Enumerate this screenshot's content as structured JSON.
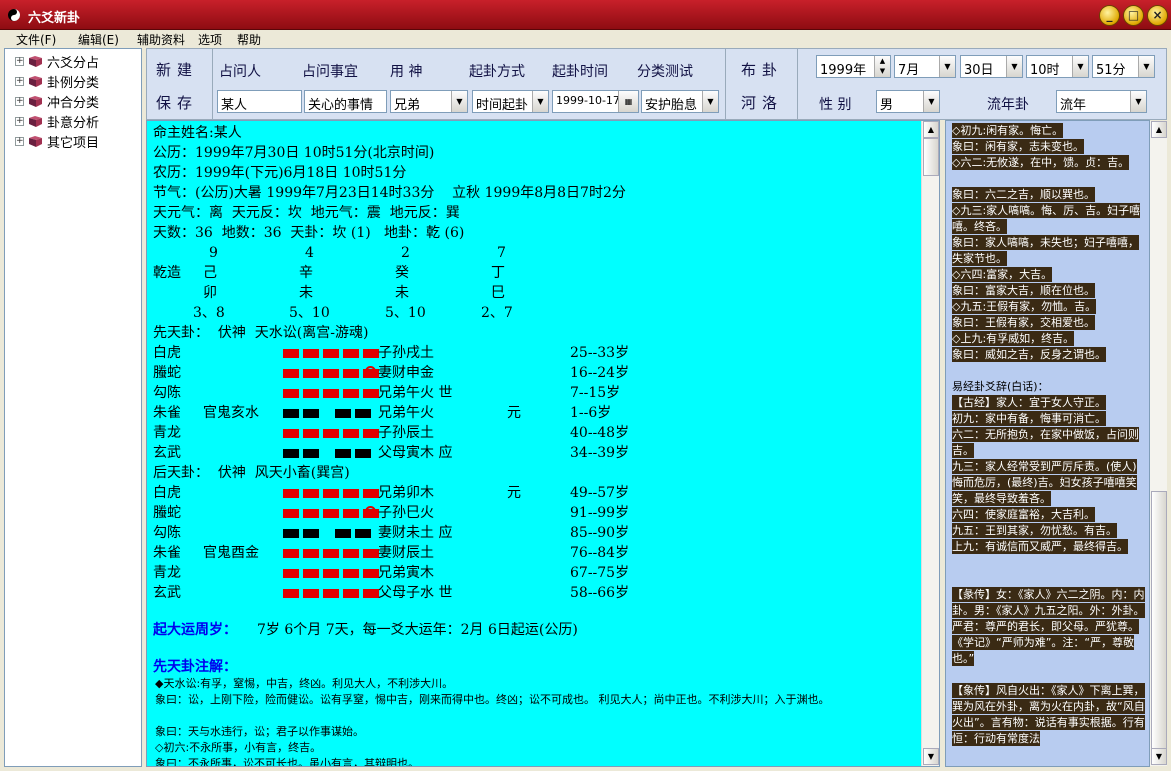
{
  "window": {
    "title": "六爻新卦",
    "min": "_",
    "max": "□",
    "close": "×"
  },
  "menu": [
    "文件(F)",
    "编辑(E)",
    "辅助资料",
    "选项",
    "帮助"
  ],
  "tree": [
    "六爻分占",
    "卦例分类",
    "冲合分类",
    "卦意分析",
    "其它项目"
  ],
  "toolbar": {
    "new": "新建",
    "save": "保存",
    "layout": "布卦",
    "heluo": "河洛",
    "col_person": "占问人",
    "col_matter": "占问事宜",
    "col_god": "用 神",
    "col_method": "起卦方式",
    "col_time": "起卦时间",
    "col_category": "分类测试",
    "person": "某人",
    "matter": "关心的事情",
    "god": "兄弟",
    "method": "时间起卦",
    "time": "1999-10-17",
    "category": "安护胎息",
    "year": "1999年",
    "month": "7月",
    "day": "30日",
    "hour": "10时",
    "minute": "51分",
    "gender_label": "性 别",
    "gender": "男",
    "flow_label": "流年卦",
    "flow": "流年"
  },
  "main": {
    "lines": [
      "命主姓名:某人",
      "公历：1999年7月30日 10时51分(北京时间)",
      "农历：1999年(下元)6月18日 10时51分",
      "节气：(公历)大暑 1999年7月23日14时33分    立秋 1999年8月8日7时2分",
      "天元气：离  天元反：坎  地元气：震  地元反：巽",
      "天数：36  地数：36  天卦：坎 (1)   地卦：乾 (6)"
    ],
    "pillars": {
      "nums": [
        "9",
        "4",
        "2",
        "7"
      ],
      "label": "乾造",
      "stems": [
        "己",
        "辛",
        "癸",
        "丁"
      ],
      "branches": [
        "卯",
        "未",
        "未",
        "巳"
      ],
      "ranges": [
        "3、8",
        "5、10",
        "5、10",
        "2、7"
      ]
    },
    "pre_header": "先天卦：  伏神  天水讼(离宫-游魂)",
    "pre_rows": [
      {
        "god": "白虎",
        "fu": "",
        "yao": "yang",
        "moving": false,
        "rel": "子孙戌土",
        "mark": "",
        "age": "25--33岁"
      },
      {
        "god": "螣蛇",
        "fu": "",
        "yao": "yang",
        "moving": true,
        "rel": "妻财申金",
        "mark": "",
        "age": "16--24岁"
      },
      {
        "god": "勾陈",
        "fu": "",
        "yao": "yang",
        "moving": false,
        "rel": "兄弟午火 世",
        "mark": "",
        "age": "7--15岁"
      },
      {
        "god": "朱雀",
        "fu": "官鬼亥水",
        "yao": "yin",
        "moving": false,
        "rel": "兄弟午火",
        "mark": "元",
        "age": "1--6岁"
      },
      {
        "god": "青龙",
        "fu": "",
        "yao": "yang",
        "moving": false,
        "rel": "子孙辰土",
        "mark": "",
        "age": "40--48岁"
      },
      {
        "god": "玄武",
        "fu": "",
        "yao": "yin",
        "moving": false,
        "rel": "父母寅木 应",
        "mark": "",
        "age": "34--39岁"
      }
    ],
    "post_header": "后天卦：  伏神  风天小畜(巽宫)",
    "post_rows": [
      {
        "god": "白虎",
        "fu": "",
        "yao": "yang",
        "moving": false,
        "rel": "兄弟卯木",
        "mark": "元",
        "age": "49--57岁"
      },
      {
        "god": "螣蛇",
        "fu": "",
        "yao": "yang",
        "moving": true,
        "rel": "子孙巳火",
        "mark": "",
        "age": "91--99岁"
      },
      {
        "god": "勾陈",
        "fu": "",
        "yao": "yin",
        "moving": false,
        "rel": "妻财未土 应",
        "mark": "",
        "age": "85--90岁"
      },
      {
        "god": "朱雀",
        "fu": "官鬼酉金",
        "yao": "yang",
        "moving": false,
        "rel": "妻财辰土",
        "mark": "",
        "age": "76--84岁"
      },
      {
        "god": "青龙",
        "fu": "",
        "yao": "yang",
        "moving": false,
        "rel": "兄弟寅木",
        "mark": "",
        "age": "67--75岁"
      },
      {
        "god": "玄武",
        "fu": "",
        "yao": "yang",
        "moving": false,
        "rel": "父母子水 世",
        "mark": "",
        "age": "58--66岁"
      }
    ],
    "dayun_label": "起大运周岁：",
    "dayun": "7岁 6个月 7天，每一爻大运年：2月 6日起运(公历)",
    "note_title": "先天卦注解：",
    "notes": [
      "◆天水讼:有孚，窒惕，中吉，终凶。利见大人，不利涉大川。",
      "    象曰：讼，上刚下险，险而健讼。讼有孚窒，惕中吉，刚来而得中也。终凶；讼不可成也。  利见大人；尚中正也。不利涉大川；入于渊也。",
      "    象曰：天与水违行，讼；君子以作事谋始。",
      "◇初六:不永所事，小有言，终吉。",
      "    象曰：不永所事，讼不可长也。虽小有言，其辩明也。"
    ]
  },
  "right": {
    "blocks": [
      "◇初九:闲有家。悔亡。",
      "  象曰：闲有家，志未变也。",
      "◇六二:无攸遂，在中，馈。贞：吉。",
      "  象曰：六二之吉，顺以巽也。",
      "◇九三:家人嗃嗃。悔、厉、吉。妇子嘻嘻。终吝。",
      "  象曰：家人嗃嗃，未失也；妇子嘻嘻，失家节也。",
      "◇六四:富家，大吉。",
      "  象曰：富家大吉，顺在位也。",
      "◇九五:王假有家，勿恤。吉。",
      "  象曰：王假有家，交相爱也。",
      "◇上九:有孚威如，终吉。",
      "  象曰：威如之吉，反身之谓也。"
    ],
    "plain_title": "易经卦爻辞(白话)：",
    "plain": [
      "【古经】家人：宜于女人守正。",
      "  初九：家中有备，悔事可消亡。",
      "  六二：无所抱负，在家中做饭，占问则吉。",
      "  九三：家人经常受到严厉斥责。(使人)悔而危厉，(最终)吉。妇女孩子嘻嘻笑笑，最终导致羞吝。",
      "  六四：使家庭富裕，大吉利。",
      "  九五：王到其家，勿忧愁。有吉。",
      "  上九：有诚信而又威严，最终得吉。"
    ],
    "xiang": "【彖传】女：《家人》六二之阴。内：内卦。男：《家人》九五之阳。外：外卦。严君：尊严的君长，即父母。严犹尊。《学记》“严师为难”。注：“严，尊敬也。”",
    "xiang2": "【象传】风自火出：《家人》下离上巽，巽为风在外卦，离为火在内卦，故“风自火出”。言有物：说话有事实根据。行有恒：行动有常度法"
  }
}
